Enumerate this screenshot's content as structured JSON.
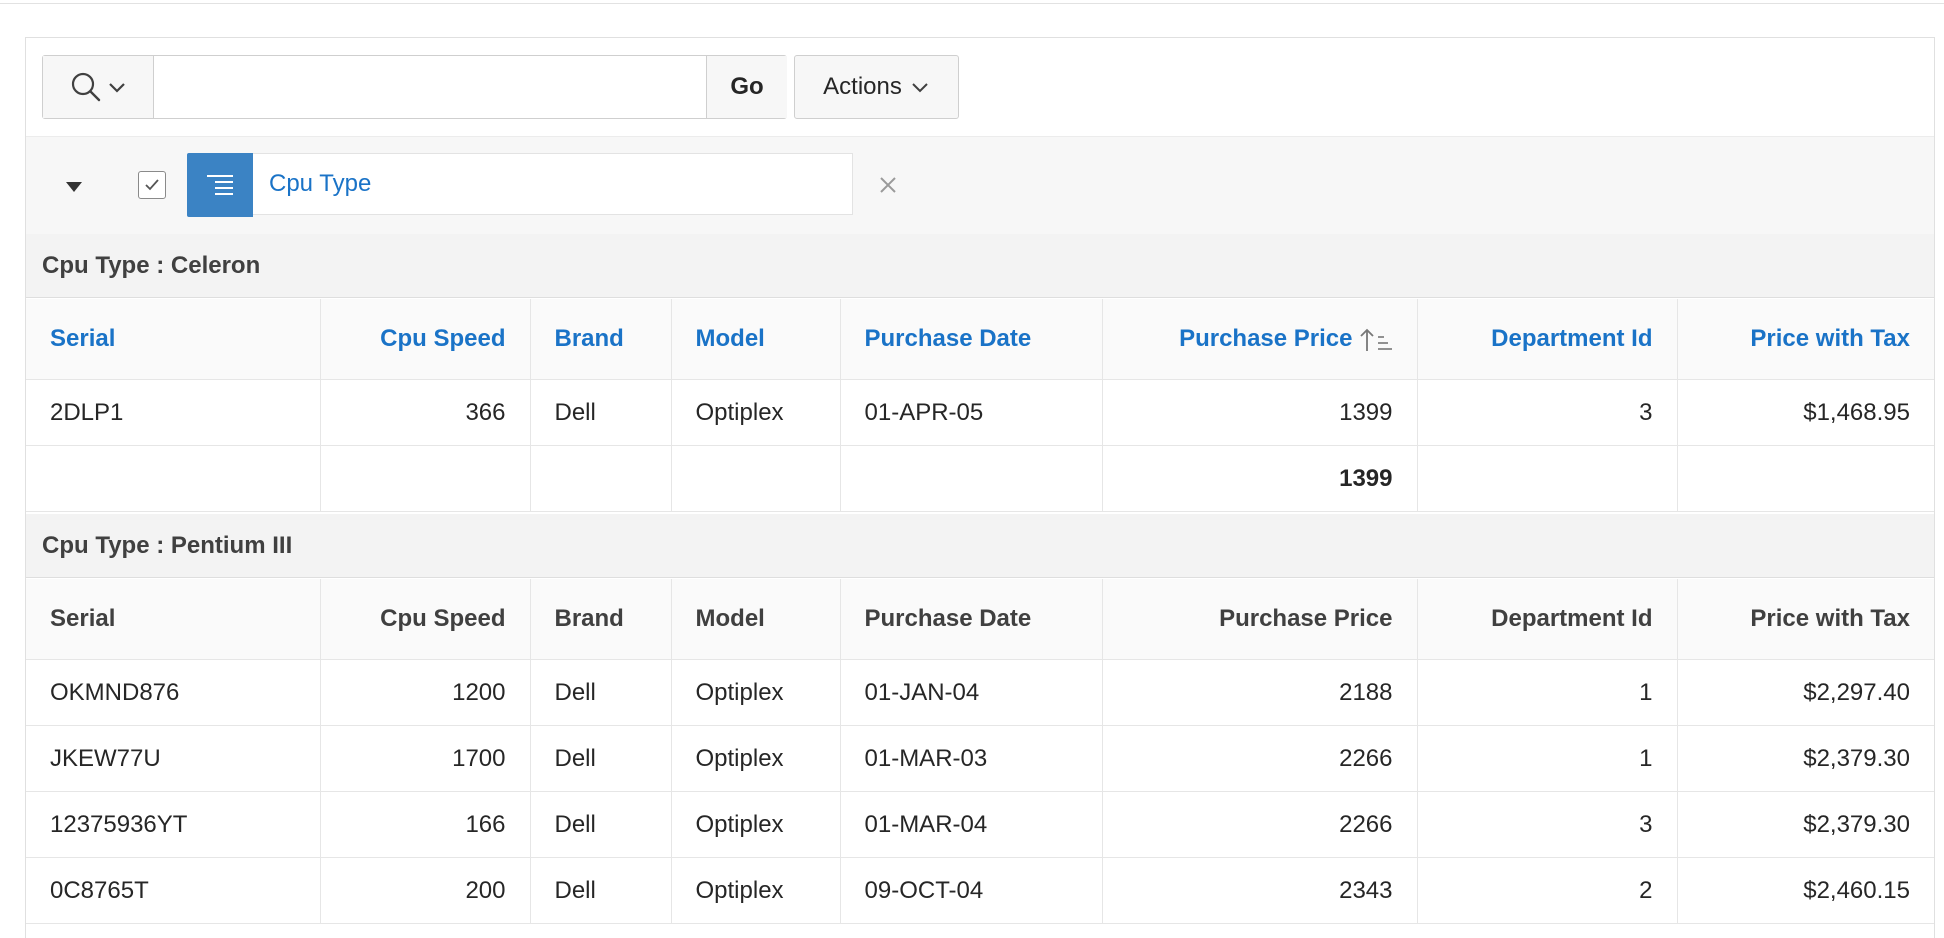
{
  "toolbar": {
    "search_value": "",
    "go_label": "Go",
    "actions_label": "Actions"
  },
  "controls": {
    "break_label": "Cpu Type"
  },
  "columns": [
    "Serial",
    "Cpu Speed",
    "Brand",
    "Model",
    "Purchase Date",
    "Purchase Price",
    "Department Id",
    "Price with Tax"
  ],
  "groups": [
    {
      "header": "Cpu Type : Celeron",
      "rows": [
        [
          "2DLP1",
          "366",
          "Dell",
          "Optiplex",
          "01-APR-05",
          "1399",
          "3",
          "$1,468.95"
        ]
      ],
      "sum": "1399"
    },
    {
      "header": "Cpu Type : Pentium III",
      "rows": [
        [
          "OKMND876",
          "1200",
          "Dell",
          "Optiplex",
          "01-JAN-04",
          "2188",
          "1",
          "$2,297.40"
        ],
        [
          "JKEW77U",
          "1700",
          "Dell",
          "Optiplex",
          "01-MAR-03",
          "2266",
          "1",
          "$2,379.30"
        ],
        [
          "12375936YT",
          "166",
          "Dell",
          "Optiplex",
          "01-MAR-04",
          "2266",
          "3",
          "$2,379.30"
        ],
        [
          "0C8765T",
          "200",
          "Dell",
          "Optiplex",
          "09-OCT-04",
          "2343",
          "2",
          "$2,460.15"
        ]
      ]
    }
  ],
  "colors": {
    "link": "#1a73c7",
    "accent": "#3b83c4",
    "header_bg": "#f3f3f3"
  },
  "icons": [
    "search-icon",
    "chevron-down-icon",
    "collapse-triangle-icon",
    "checkmark-icon",
    "control-break-icon",
    "close-icon",
    "sort-ascending-icon"
  ]
}
